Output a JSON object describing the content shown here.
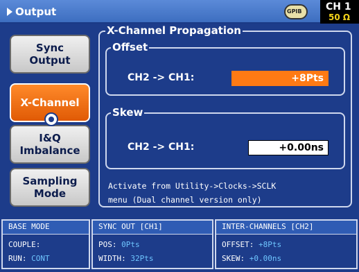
{
  "titlebar": {
    "title": "Output",
    "gpib_label": "GPIB",
    "channel": "CH 1",
    "impedance": "50 Ω"
  },
  "softkeys": [
    {
      "line1": "Sync",
      "line2": "Output"
    },
    {
      "line1": "X-Channel",
      "line2": ""
    },
    {
      "line1": "I&Q",
      "line2": "Imbalance"
    },
    {
      "line1": "Sampling",
      "line2": "Mode"
    }
  ],
  "content": {
    "group_title": "X-Channel Propagation",
    "offset": {
      "title": "Offset",
      "label": "CH2 -> CH1:",
      "value": "+8Pts"
    },
    "skew": {
      "title": "Skew",
      "label": "CH2 -> CH1:",
      "value": "+0.00ns"
    },
    "note_line1": "Activate from Utility->Clocks->SCLK",
    "note_line2": "menu (Dual channel version only)"
  },
  "status": {
    "base_mode": {
      "header": "BASE MODE",
      "row1_label": "COUPLE:",
      "row1_value": "",
      "row2_label": "RUN:",
      "row2_value": "CONT"
    },
    "sync_out": {
      "header": "SYNC OUT [CH1]",
      "row1_label": "POS:",
      "row1_value": "0Pts",
      "row2_label": "WIDTH:",
      "row2_value": "32Pts"
    },
    "inter_channels": {
      "header": "INTER-CHANNELS [CH2]",
      "row1_label": "OFFSET:",
      "row1_value": "+8Pts",
      "row2_label": "SKEW:",
      "row2_value": "+0.00ns"
    }
  },
  "colors": {
    "background": "#1d3c8a",
    "active": "#ff7a14",
    "value_text": "#6fc6ff",
    "impedance": "#f2d21a"
  }
}
